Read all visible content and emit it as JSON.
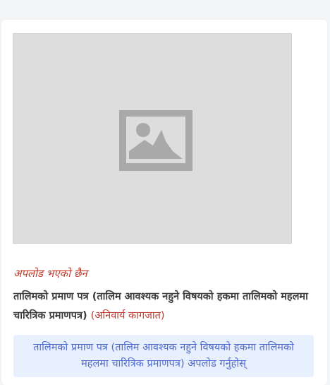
{
  "upload": {
    "status": "अपलोड भएको छैन",
    "document_title": "तालिमको प्रमाण पत्र (तालिम आवश्यक नहुने विषयको हकमा तालिमको महलमा चारित्रिक प्रमाणपत्र)",
    "required_label": "(अनिवार्य कागजात)",
    "button_label": "तालिमको प्रमाण पत्र (तालिम आवश्यक नहुने विषयको हकमा तालिमको महलमा चारित्रिक प्रमाणपत्र) अपलोड गर्नुहोस्",
    "preview_icon": "image-placeholder-icon"
  },
  "colors": {
    "required": "#c0392b",
    "button_bg": "#e8effd",
    "button_text": "#4f6bd1",
    "preview_bg": "#dddddd"
  }
}
